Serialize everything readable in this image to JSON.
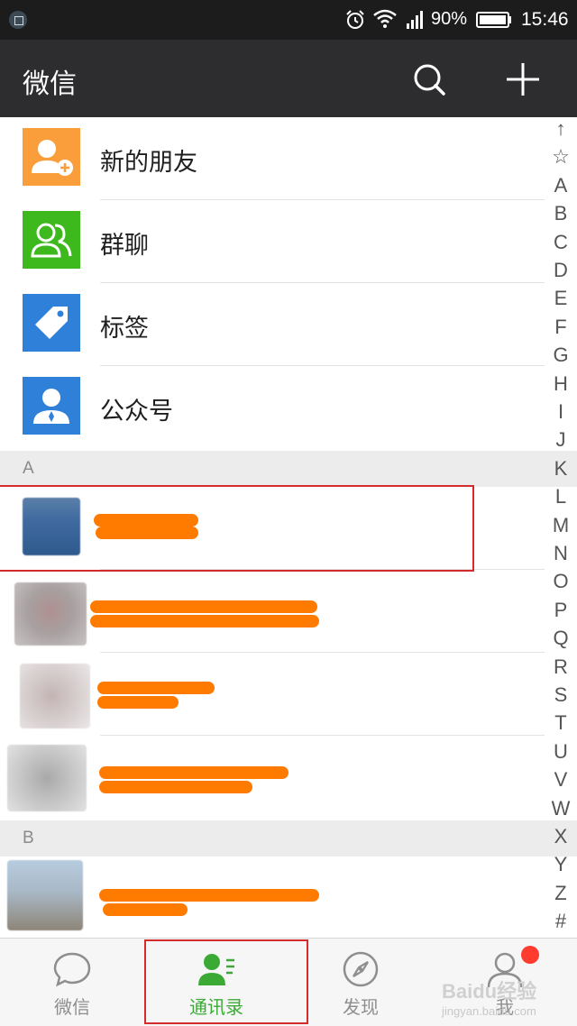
{
  "status_bar": {
    "battery_percent": "90%",
    "time": "15:46"
  },
  "app_bar": {
    "title": "微信"
  },
  "features": [
    {
      "label": "新的朋友",
      "icon": "new-friends-icon",
      "color": "#FA9D3B"
    },
    {
      "label": "群聊",
      "icon": "group-chat-icon",
      "color": "#3DB81D"
    },
    {
      "label": "标签",
      "icon": "tag-icon",
      "color": "#2F80D8"
    },
    {
      "label": "公众号",
      "icon": "official-account-icon",
      "color": "#2F80D8"
    }
  ],
  "sections": [
    "A",
    "B"
  ],
  "index_letters": [
    "↑",
    "☆",
    "A",
    "B",
    "C",
    "D",
    "E",
    "F",
    "G",
    "H",
    "I",
    "J",
    "K",
    "L",
    "M",
    "N",
    "O",
    "P",
    "Q",
    "R",
    "S",
    "T",
    "U",
    "V",
    "W",
    "X",
    "Y",
    "Z",
    "#"
  ],
  "tabs": [
    {
      "label": "微信",
      "icon": "chat-bubble-icon",
      "active": false
    },
    {
      "label": "通讯录",
      "icon": "contacts-icon",
      "active": true
    },
    {
      "label": "发现",
      "icon": "compass-icon",
      "active": false
    },
    {
      "label": "我",
      "icon": "me-icon",
      "active": false,
      "badge": true
    }
  ],
  "watermark": {
    "text": "Baidu经验",
    "sub": "jingyan.baidu.com"
  },
  "colors": {
    "accent": "#3AAA35",
    "redaction": "#FF7B00",
    "highlight": "#D62B2B",
    "badge": "#FF3B30"
  }
}
